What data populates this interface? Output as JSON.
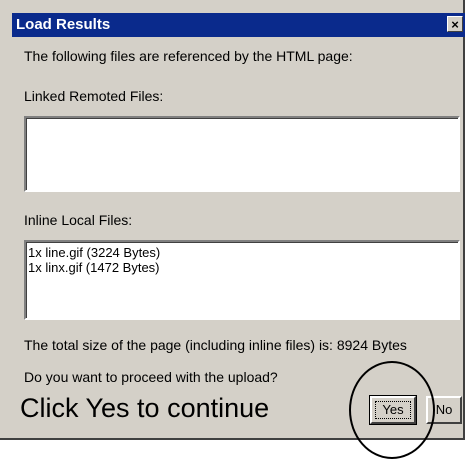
{
  "dialog": {
    "title": "Load Results",
    "close_label": "×",
    "intro_text": "The following files are referenced by the HTML page:",
    "linked_label": "Linked Remoted Files:",
    "linked_files": [],
    "inline_label": "Inline Local Files:",
    "inline_files": [
      "1x line.gif (3224 Bytes)",
      "1x linx.gif (1472 Bytes)"
    ],
    "total_size_text": "The total size of the page (including inline files) is: 8924 Bytes",
    "question_text": "Do you want to proceed with the upload?",
    "yes_label": "Yes",
    "no_label": "No"
  },
  "annotation": {
    "instruction_text": "Click Yes to continue"
  },
  "colors": {
    "titlebar": "#0a2a8c",
    "dialog_face": "#d4d0c8"
  }
}
